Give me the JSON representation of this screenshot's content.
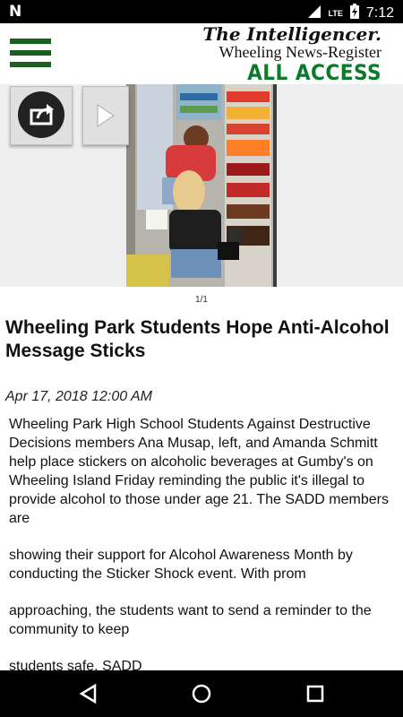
{
  "status_bar": {
    "carrier_icon": "N",
    "network": "LTE",
    "time": "7:12"
  },
  "header": {
    "menu_icon": "hamburger-icon",
    "brand_line1": "The Intelligencer.",
    "brand_line2": "Wheeling News-Register",
    "brand_line3": "ALL ACCESS",
    "brand_color": "#0b7a2a"
  },
  "gallery": {
    "counter": "1/1"
  },
  "article": {
    "title": "Wheeling Park Students Hope Anti-Alcohol Message Sticks",
    "date": "Apr 17, 2018 12:00 AM",
    "paragraphs": [
      "Wheeling Park High School Students Against Destructive Decisions members Ana Musap, left, and Amanda Schmitt help place stickers on alcoholic beverages at Gumby's on Wheeling Island Friday reminding the public it's illegal to provide alcohol to those under age 21. The SADD members are",
      "showing their support for Alcohol Awareness Month by conducting the Sticker Shock event. With prom",
      "approaching, the students want to send a reminder to the community to keep",
      "students safe. SADD"
    ]
  }
}
